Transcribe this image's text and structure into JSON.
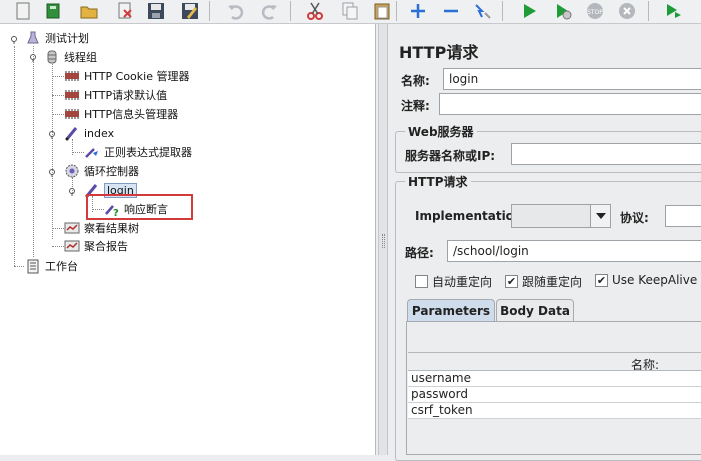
{
  "toolbar": {
    "buttons": [
      {
        "name": "new-icon",
        "color": "#f2f2f2"
      },
      {
        "name": "templates-icon",
        "color": "#2f8f3a"
      },
      {
        "name": "open-icon",
        "color": "#e2b243"
      },
      {
        "name": "close-file-icon",
        "color": "#d23b3b"
      },
      {
        "name": "save-icon",
        "color": "#3d4a5c"
      },
      {
        "name": "save-as-icon",
        "color": "#3d4a5c"
      },
      {
        "name": "undo-icon",
        "color": "#b8bcc2"
      },
      {
        "name": "redo-icon",
        "color": "#b8bcc2"
      },
      {
        "name": "cut-icon",
        "color": "#d23b3b"
      },
      {
        "name": "copy-icon",
        "color": "#9aa0a8"
      },
      {
        "name": "paste-icon",
        "color": "#c9a45c"
      },
      {
        "name": "expand-icon",
        "color": "#2a6fd6"
      },
      {
        "name": "collapse-icon",
        "color": "#2a6fd6"
      },
      {
        "name": "toggle-icon",
        "color": "#2a6fd6"
      },
      {
        "name": "start-icon",
        "color": "#1f9c37"
      },
      {
        "name": "start-no-pause-icon",
        "color": "#1f9c37"
      },
      {
        "name": "stop-icon",
        "color": "#b4b7bb"
      },
      {
        "name": "shutdown-icon",
        "color": "#b4b7bb"
      },
      {
        "name": "remote-start-icon",
        "color": "#1f9c37"
      }
    ]
  },
  "tree": {
    "nodes": [
      {
        "label": "测试计划",
        "icon": "flask-icon"
      },
      {
        "label": "线程组",
        "icon": "thread-group-icon"
      },
      {
        "label": "HTTP Cookie 管理器",
        "icon": "config-element-icon"
      },
      {
        "label": "HTTP请求默认值",
        "icon": "config-element-icon"
      },
      {
        "label": "HTTP信息头管理器",
        "icon": "config-element-icon"
      },
      {
        "label": "index",
        "icon": "sampler-icon"
      },
      {
        "label": "正则表达式提取器",
        "icon": "post-processor-icon"
      },
      {
        "label": "循环控制器",
        "icon": "loop-controller-icon"
      },
      {
        "label": "login",
        "icon": "sampler-icon"
      },
      {
        "label": "响应断言",
        "icon": "assertion-icon"
      },
      {
        "label": "察看结果树",
        "icon": "listener-icon"
      },
      {
        "label": "聚合报告",
        "icon": "listener-icon"
      },
      {
        "label": "工作台",
        "icon": "workbench-icon"
      }
    ]
  },
  "panel": {
    "title": "HTTP请求",
    "name_label": "名称:",
    "name_value": "login",
    "comment_label": "注释:",
    "comment_value": "",
    "web_server_group": "Web服务器",
    "server_label": "服务器名称或IP:",
    "server_value": "",
    "http_request_group": "HTTP请求",
    "implementation_label": "Implementation:",
    "implementation_value": "",
    "protocol_label": "协议:",
    "protocol_value": "",
    "path_label": "路径:",
    "path_value": "/school/login",
    "checkboxes": [
      {
        "label": "自动重定向",
        "checked": false
      },
      {
        "label": "跟随重定向",
        "checked": true
      },
      {
        "label": "Use KeepAlive",
        "checked": true
      }
    ],
    "tabs": [
      {
        "label": "Parameters",
        "active": true
      },
      {
        "label": "Body Data",
        "active": false
      }
    ],
    "table": {
      "header": "名称:",
      "rows": [
        "username",
        "password",
        "csrf_token"
      ]
    }
  }
}
